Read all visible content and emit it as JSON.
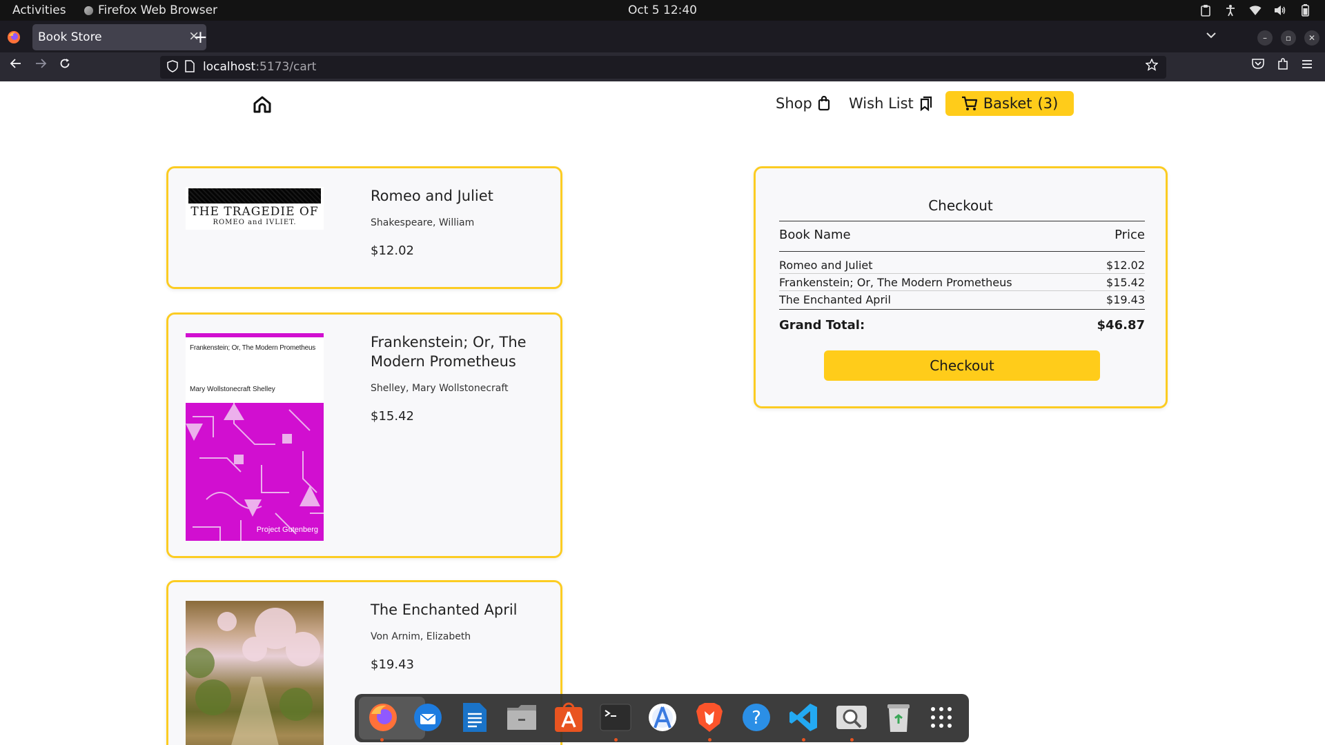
{
  "system_bar": {
    "activities": "Activities",
    "app_name": "Firefox Web Browser",
    "datetime": "Oct 5  12:40"
  },
  "browser": {
    "tab_title": "Book Store",
    "url_host": "localhost",
    "url_rest": ":5173/cart"
  },
  "site_nav": {
    "shop": "Shop",
    "wishlist": "Wish List",
    "basket": "Basket",
    "basket_count": "(3)"
  },
  "cart_items": [
    {
      "title": "Romeo and Juliet",
      "author": "Shakespeare, William",
      "price": "$12.02",
      "cover_title": "THE TRAGEDIE OF",
      "cover_sub": "ROMEO and IVLIET."
    },
    {
      "title": "Frankenstein; Or, The Modern Prometheus",
      "author": "Shelley, Mary Wollstonecraft",
      "price": "$15.42",
      "cover_title": "Frankenstein; Or, The Modern Prometheus",
      "cover_author": "Mary Wollstonecraft Shelley",
      "cover_publisher": "Project Gutenberg"
    },
    {
      "title": "The Enchanted April",
      "author": "Von Arnim, Elizabeth",
      "price": "$19.43"
    }
  ],
  "checkout": {
    "heading": "Checkout",
    "col_name": "Book Name",
    "col_price": "Price",
    "rows": [
      {
        "name": "Romeo and Juliet",
        "price": "$12.02"
      },
      {
        "name": "Frankenstein; Or, The Modern Prometheus",
        "price": "$15.42"
      },
      {
        "name": "The Enchanted April",
        "price": "$19.43"
      }
    ],
    "total_label": "Grand Total:",
    "total_value": "$46.87",
    "button": "Checkout"
  },
  "dock": {
    "apps": [
      "firefox-icon",
      "thunderbird-icon",
      "writer-icon",
      "files-icon",
      "app-center-icon",
      "terminal-icon",
      "android-studio-icon",
      "brave-icon",
      "help-icon",
      "vscode-icon",
      "screenshot-icon",
      "trash-icon",
      "show-apps-icon"
    ]
  },
  "colors": {
    "accent": "#ffcc1a",
    "card_border": "#fccc22",
    "frankenstein_cover": "#d10fd0"
  }
}
